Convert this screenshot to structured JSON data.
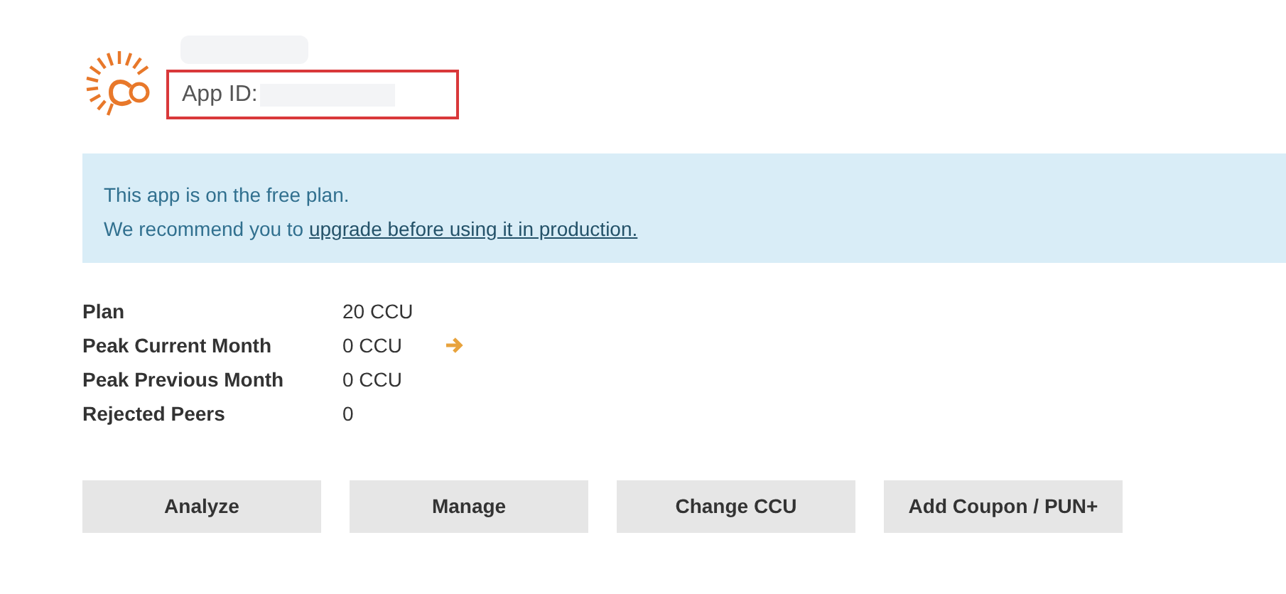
{
  "app": {
    "id_label": "App ID:"
  },
  "notice": {
    "line_1": "This app is on the free plan.",
    "line_2_prefix": "We recommend you to",
    "link": "upgrade before using it in production."
  },
  "stats": [
    {
      "label": "Plan",
      "value": "20 CCU"
    },
    {
      "label": "Peak Current Month",
      "value": "0 CCU",
      "arrow": true
    },
    {
      "label": "Peak Previous Month",
      "value": "0 CCU"
    },
    {
      "label": "Rejected Peers",
      "value": "0"
    }
  ],
  "buttons": [
    "Analyze",
    "Manage",
    "Change CCU",
    "Add Coupon / PUN+"
  ]
}
